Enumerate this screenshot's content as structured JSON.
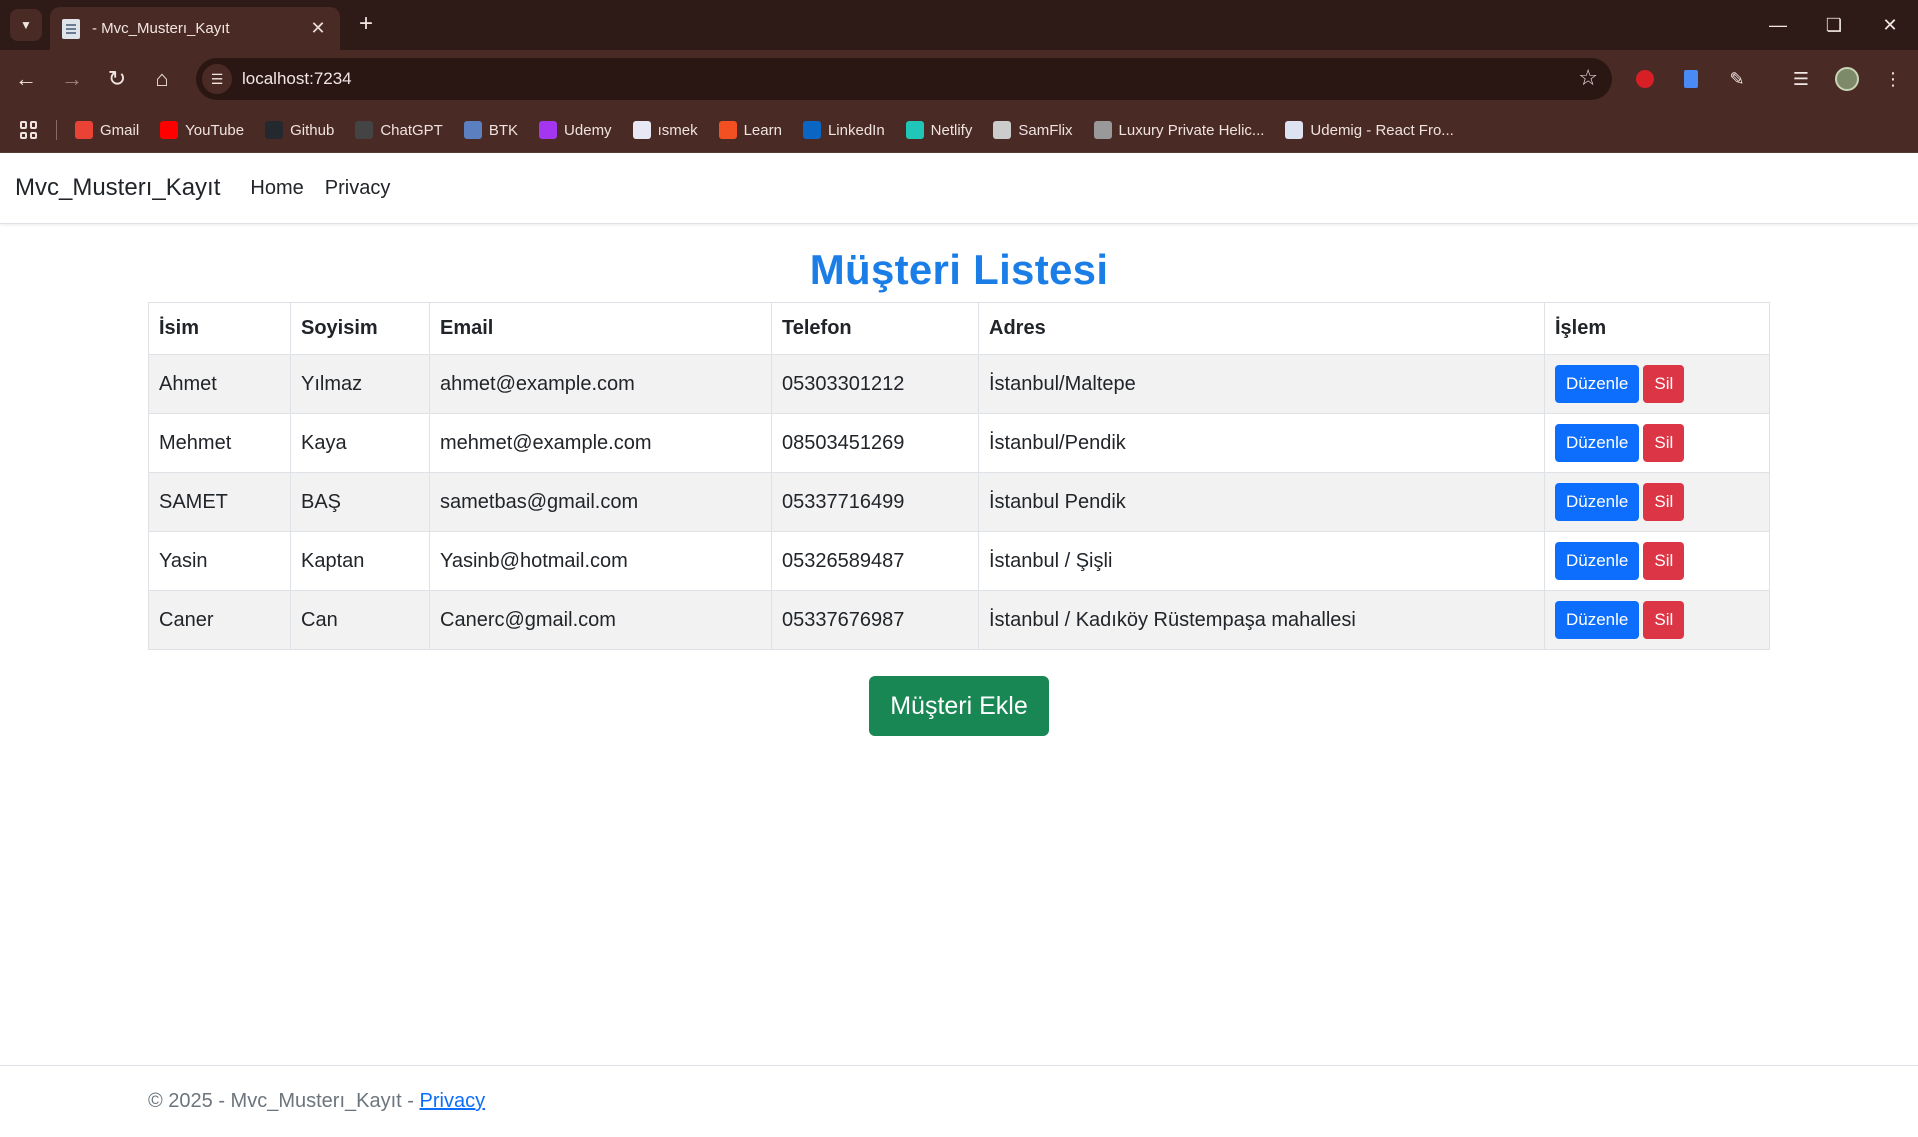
{
  "browser": {
    "tab_title": "- Mvc_Musterı_Kayıt",
    "url": "localhost:7234",
    "bookmarks": [
      {
        "label": "Gmail",
        "icon": "gmail-icon",
        "color": "#ea4335"
      },
      {
        "label": "YouTube",
        "icon": "youtube-icon",
        "color": "#ff0000"
      },
      {
        "label": "Github",
        "icon": "github-icon",
        "color": "#24292f"
      },
      {
        "label": "ChatGPT",
        "icon": "chatgpt-icon",
        "color": "#444444"
      },
      {
        "label": "BTK",
        "icon": "btk-icon",
        "color": "#5b7fbf"
      },
      {
        "label": "Udemy",
        "icon": "udemy-icon",
        "color": "#a435f0"
      },
      {
        "label": "ısmek",
        "icon": "ismek-icon",
        "color": "#e8e8f5"
      },
      {
        "label": "Learn",
        "icon": "microsoft-icon",
        "color": "#f25022"
      },
      {
        "label": "LinkedIn",
        "icon": "linkedin-icon",
        "color": "#0a66c2"
      },
      {
        "label": "Netlify",
        "icon": "netlify-icon",
        "color": "#20c6b7"
      },
      {
        "label": "SamFlix",
        "icon": "samflix-icon",
        "color": "#cccccc"
      },
      {
        "label": "Luxury Private Helic...",
        "icon": "helicopter-icon",
        "color": "#999999"
      },
      {
        "label": "Udemig - React Fro...",
        "icon": "udemig-icon",
        "color": "#dde3f0"
      }
    ]
  },
  "app": {
    "brand": "Mvc_Musterı_Kayıt",
    "nav": [
      "Home",
      "Privacy"
    ]
  },
  "main": {
    "title": "Müşteri Listesi",
    "columns": [
      "İsim",
      "Soyisim",
      "Email",
      "Telefon",
      "Adres",
      "İşlem"
    ],
    "rows": [
      [
        "Ahmet",
        "Yılmaz",
        "ahmet@example.com",
        "05303301212",
        "İstanbul/Maltepe"
      ],
      [
        "Mehmet",
        "Kaya",
        "mehmet@example.com",
        "08503451269",
        "İstanbul/Pendik"
      ],
      [
        "SAMET",
        "BAŞ",
        "sametbas@gmail.com",
        "05337716499",
        "İstanbul Pendik"
      ],
      [
        "Yasin",
        "Kaptan",
        "Yasinb@hotmail.com",
        "05326589487",
        "İstanbul / Şişli"
      ],
      [
        "Caner",
        "Can",
        "Canerc@gmail.com",
        "05337676987",
        "İstanbul / Kadıköy Rüstempaşa mahallesi"
      ]
    ],
    "edit_label": "Düzenle",
    "delete_label": "Sil",
    "add_label": "Müşteri Ekle"
  },
  "footer": {
    "text": "© 2025 - Mvc_Musterı_Kayıt - ",
    "link": "Privacy"
  }
}
